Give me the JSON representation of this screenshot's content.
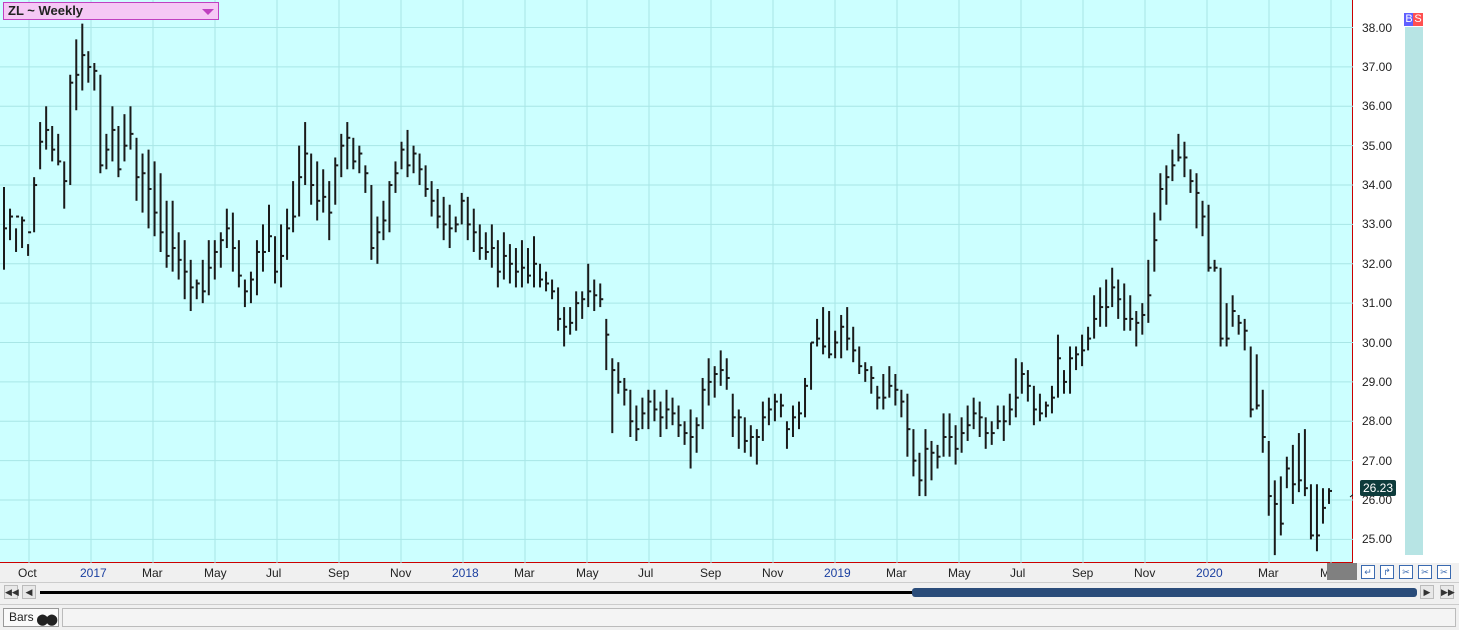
{
  "symbol_selector": {
    "label": "ZL ~ Weekly"
  },
  "buy_label": "B",
  "sell_label": "S",
  "last_price": "26.23",
  "bottom_tab": {
    "label": "Bars"
  },
  "colors": {
    "plot_bg": "#ccffff",
    "grid": "#a8e6e6",
    "bars": "#1a1a1a",
    "border": "#cc0000",
    "year_label": "#1a3fa0"
  },
  "nav_icons": [
    "arrow-left-icon",
    "arrow-right-icon",
    "zoom-in-icon",
    "zoom-out-icon",
    "collapse-icon"
  ],
  "chart_data": {
    "type": "ohlc",
    "y_tick_labels": [
      "38.00",
      "37.00",
      "36.00",
      "35.00",
      "34.00",
      "33.00",
      "32.00",
      "31.00",
      "30.00",
      "29.00",
      "28.00",
      "27.00",
      "26.00",
      "25.00"
    ],
    "ylim": [
      24.4,
      38.7
    ],
    "x_tick_labels": [
      {
        "label": "Oct",
        "year": false
      },
      {
        "label": "2017",
        "year": true
      },
      {
        "label": "Mar",
        "year": false
      },
      {
        "label": "May",
        "year": false
      },
      {
        "label": "Jul",
        "year": false
      },
      {
        "label": "Sep",
        "year": false
      },
      {
        "label": "Nov",
        "year": false
      },
      {
        "label": "2018",
        "year": true
      },
      {
        "label": "Mar",
        "year": false
      },
      {
        "label": "May",
        "year": false
      },
      {
        "label": "Jul",
        "year": false
      },
      {
        "label": "Sep",
        "year": false
      },
      {
        "label": "Nov",
        "year": false
      },
      {
        "label": "2019",
        "year": true
      },
      {
        "label": "Mar",
        "year": false
      },
      {
        "label": "May",
        "year": false
      },
      {
        "label": "Jul",
        "year": false
      },
      {
        "label": "Sep",
        "year": false
      },
      {
        "label": "Nov",
        "year": false
      },
      {
        "label": "2020",
        "year": true
      },
      {
        "label": "Mar",
        "year": false
      },
      {
        "label": "May",
        "year": false
      }
    ],
    "grid": true,
    "series": [
      {
        "values": [
          [
            33.95,
            31.85,
            32.9
          ],
          [
            33.4,
            32.6,
            33.2
          ],
          [
            32.9,
            32.3,
            33.2
          ],
          [
            33.2,
            32.4,
            33.1
          ],
          [
            32.5,
            32.2,
            32.8
          ],
          [
            34.2,
            32.8,
            34.0
          ],
          [
            35.6,
            34.4,
            35.1
          ],
          [
            36.0,
            34.9,
            35.4
          ],
          [
            35.5,
            34.6,
            34.9
          ],
          [
            35.3,
            34.5,
            34.6
          ],
          [
            34.6,
            33.4,
            34.1
          ],
          [
            36.8,
            34.0,
            36.6
          ],
          [
            37.7,
            35.9,
            36.8
          ],
          [
            38.1,
            36.4,
            37.3
          ],
          [
            37.4,
            36.6,
            37.0
          ],
          [
            37.1,
            36.4,
            36.9
          ],
          [
            36.8,
            34.3,
            34.5
          ],
          [
            35.3,
            34.4,
            34.9
          ],
          [
            36.0,
            34.6,
            35.4
          ],
          [
            35.5,
            34.2,
            34.4
          ],
          [
            35.8,
            34.6,
            35.0
          ],
          [
            36.0,
            34.9,
            35.3
          ],
          [
            35.2,
            33.6,
            34.2
          ],
          [
            34.8,
            33.3,
            34.3
          ],
          [
            34.9,
            32.9,
            33.9
          ],
          [
            34.6,
            32.7,
            33.3
          ],
          [
            34.3,
            32.3,
            32.8
          ],
          [
            33.6,
            31.9,
            32.2
          ],
          [
            33.6,
            31.8,
            32.4
          ],
          [
            32.8,
            31.6,
            32.1
          ],
          [
            32.6,
            31.1,
            31.8
          ],
          [
            32.1,
            30.8,
            31.4
          ],
          [
            31.6,
            31.1,
            31.5
          ],
          [
            32.1,
            31.0,
            31.3
          ],
          [
            32.6,
            31.2,
            31.9
          ],
          [
            32.6,
            31.6,
            32.3
          ],
          [
            32.8,
            31.9,
            32.6
          ],
          [
            33.4,
            32.4,
            32.9
          ],
          [
            33.3,
            31.8,
            32.4
          ],
          [
            32.6,
            31.4,
            31.7
          ],
          [
            31.6,
            30.9,
            31.3
          ],
          [
            31.8,
            31.0,
            31.6
          ],
          [
            32.6,
            31.2,
            32.3
          ],
          [
            33.0,
            31.8,
            32.3
          ],
          [
            33.5,
            32.3,
            32.7
          ],
          [
            32.7,
            31.5,
            31.8
          ],
          [
            33.0,
            31.4,
            32.2
          ],
          [
            33.4,
            32.1,
            32.9
          ],
          [
            34.1,
            32.8,
            33.2
          ],
          [
            35.0,
            33.2,
            34.2
          ],
          [
            35.6,
            34.0,
            34.8
          ],
          [
            34.8,
            33.5,
            34.0
          ],
          [
            34.6,
            33.1,
            33.6
          ],
          [
            34.4,
            33.3,
            33.7
          ],
          [
            34.1,
            32.6,
            33.3
          ],
          [
            34.7,
            33.5,
            34.5
          ],
          [
            35.3,
            34.2,
            35.0
          ],
          [
            35.6,
            34.4,
            35.2
          ],
          [
            35.2,
            34.4,
            34.6
          ],
          [
            35.0,
            34.3,
            34.8
          ],
          [
            34.5,
            33.8,
            34.3
          ],
          [
            34.0,
            32.1,
            32.4
          ],
          [
            33.2,
            32.0,
            32.8
          ],
          [
            33.6,
            32.6,
            33.1
          ],
          [
            34.1,
            32.8,
            34.0
          ],
          [
            34.6,
            33.8,
            34.3
          ],
          [
            35.1,
            34.4,
            34.9
          ],
          [
            35.4,
            34.2,
            34.5
          ],
          [
            35.0,
            34.3,
            34.8
          ],
          [
            34.8,
            34.0,
            34.4
          ],
          [
            34.5,
            33.7,
            33.9
          ],
          [
            34.1,
            33.2,
            33.6
          ],
          [
            33.9,
            32.9,
            33.2
          ],
          [
            33.7,
            32.6,
            33.0
          ],
          [
            33.5,
            32.4,
            32.9
          ],
          [
            33.2,
            32.8,
            33.0
          ],
          [
            33.8,
            33.0,
            33.6
          ],
          [
            33.7,
            32.6,
            33.0
          ],
          [
            33.4,
            32.3,
            32.8
          ],
          [
            33.0,
            32.1,
            32.4
          ],
          [
            32.8,
            32.1,
            32.3
          ],
          [
            33.0,
            31.9,
            32.4
          ],
          [
            32.6,
            31.4,
            31.8
          ],
          [
            32.8,
            31.6,
            32.2
          ],
          [
            32.5,
            31.5,
            32.0
          ],
          [
            32.4,
            31.4,
            31.8
          ],
          [
            32.6,
            31.4,
            31.9
          ],
          [
            32.4,
            31.5,
            31.7
          ],
          [
            32.7,
            31.4,
            32.0
          ],
          [
            32.0,
            31.4,
            31.6
          ],
          [
            31.8,
            31.3,
            31.5
          ],
          [
            31.6,
            31.1,
            31.3
          ],
          [
            31.4,
            30.3,
            30.6
          ],
          [
            30.9,
            29.9,
            30.4
          ],
          [
            30.9,
            30.2,
            30.5
          ],
          [
            31.3,
            30.3,
            31.0
          ],
          [
            31.3,
            30.6,
            31.1
          ],
          [
            32.0,
            30.9,
            31.3
          ],
          [
            31.6,
            30.8,
            31.2
          ],
          [
            31.5,
            30.9,
            31.1
          ],
          [
            30.6,
            29.3,
            30.2
          ],
          [
            29.6,
            27.7,
            29.3
          ],
          [
            29.5,
            28.7,
            29.0
          ],
          [
            29.1,
            28.4,
            28.8
          ],
          [
            28.8,
            27.6,
            28.0
          ],
          [
            28.4,
            27.5,
            27.8
          ],
          [
            28.6,
            27.8,
            28.2
          ],
          [
            28.8,
            27.8,
            28.5
          ],
          [
            28.8,
            28.0,
            28.3
          ],
          [
            28.5,
            27.6,
            28.1
          ],
          [
            28.8,
            27.8,
            28.3
          ],
          [
            28.6,
            27.9,
            28.2
          ],
          [
            28.4,
            27.6,
            27.9
          ],
          [
            28.0,
            27.4,
            27.7
          ],
          [
            28.3,
            26.8,
            27.6
          ],
          [
            28.1,
            27.2,
            27.9
          ],
          [
            29.1,
            27.8,
            28.8
          ],
          [
            29.6,
            28.4,
            29.0
          ],
          [
            29.4,
            28.6,
            29.2
          ],
          [
            29.8,
            28.9,
            29.3
          ],
          [
            29.6,
            28.8,
            29.1
          ],
          [
            28.7,
            27.6,
            28.1
          ],
          [
            28.3,
            27.3,
            28.1
          ],
          [
            28.1,
            27.2,
            27.5
          ],
          [
            27.9,
            27.1,
            27.6
          ],
          [
            27.8,
            26.9,
            27.6
          ],
          [
            28.5,
            27.5,
            28.1
          ],
          [
            28.6,
            27.9,
            28.3
          ],
          [
            28.7,
            28.0,
            28.5
          ],
          [
            28.7,
            28.1,
            28.4
          ],
          [
            28.0,
            27.3,
            27.8
          ],
          [
            28.4,
            27.6,
            28.1
          ],
          [
            28.5,
            27.8,
            28.2
          ],
          [
            29.1,
            28.1,
            28.9
          ],
          [
            30.0,
            28.8,
            30.0
          ],
          [
            30.6,
            29.9,
            30.1
          ],
          [
            30.9,
            29.7,
            29.9
          ],
          [
            30.8,
            29.6,
            29.7
          ],
          [
            30.3,
            29.6,
            30.0
          ],
          [
            30.7,
            29.6,
            30.4
          ],
          [
            30.9,
            29.8,
            30.1
          ],
          [
            30.4,
            29.5,
            29.8
          ],
          [
            29.9,
            29.2,
            29.4
          ],
          [
            29.5,
            29.0,
            29.3
          ],
          [
            29.4,
            28.7,
            29.1
          ],
          [
            28.9,
            28.3,
            28.6
          ],
          [
            29.2,
            28.3,
            28.6
          ],
          [
            29.4,
            28.6,
            28.9
          ],
          [
            29.2,
            28.4,
            28.8
          ],
          [
            28.8,
            28.1,
            28.5
          ],
          [
            28.7,
            27.1,
            27.8
          ],
          [
            27.8,
            26.6,
            27.0
          ],
          [
            27.2,
            26.1,
            26.5
          ],
          [
            27.8,
            26.1,
            27.3
          ],
          [
            27.5,
            26.5,
            27.2
          ],
          [
            27.4,
            26.8,
            27.1
          ],
          [
            28.2,
            27.1,
            27.6
          ],
          [
            28.2,
            27.1,
            27.6
          ],
          [
            27.9,
            26.9,
            27.3
          ],
          [
            28.1,
            27.2,
            27.7
          ],
          [
            28.4,
            27.5,
            27.9
          ],
          [
            28.6,
            27.8,
            28.2
          ],
          [
            28.5,
            27.6,
            28.1
          ],
          [
            28.1,
            27.3,
            27.7
          ],
          [
            28.0,
            27.4,
            27.7
          ],
          [
            28.4,
            27.8,
            28.0
          ],
          [
            28.4,
            27.5,
            28.0
          ],
          [
            28.7,
            27.9,
            28.3
          ],
          [
            29.6,
            28.1,
            28.6
          ],
          [
            29.5,
            28.7,
            29.2
          ],
          [
            29.3,
            28.5,
            28.9
          ],
          [
            28.9,
            27.9,
            28.3
          ],
          [
            28.7,
            28.0,
            28.2
          ],
          [
            28.5,
            28.1,
            28.4
          ],
          [
            28.9,
            28.2,
            28.6
          ],
          [
            30.2,
            28.6,
            29.6
          ],
          [
            29.3,
            28.7,
            29.0
          ],
          [
            29.9,
            28.7,
            29.6
          ],
          [
            29.9,
            29.3,
            29.7
          ],
          [
            30.2,
            29.4,
            29.8
          ],
          [
            30.4,
            29.8,
            30.1
          ],
          [
            31.2,
            30.1,
            30.6
          ],
          [
            31.4,
            30.4,
            30.9
          ],
          [
            31.6,
            30.4,
            30.9
          ],
          [
            31.9,
            30.9,
            31.4
          ],
          [
            31.6,
            30.6,
            31.1
          ],
          [
            31.5,
            30.3,
            30.6
          ],
          [
            31.2,
            30.3,
            30.6
          ],
          [
            30.8,
            29.9,
            30.5
          ],
          [
            31.0,
            30.2,
            30.7
          ],
          [
            32.1,
            30.5,
            31.2
          ],
          [
            33.3,
            31.8,
            32.6
          ],
          [
            34.3,
            33.1,
            33.9
          ],
          [
            34.5,
            33.5,
            34.2
          ],
          [
            34.9,
            34.1,
            34.5
          ],
          [
            35.3,
            34.6,
            34.7
          ],
          [
            35.1,
            34.2,
            34.7
          ],
          [
            34.4,
            33.8,
            34.1
          ],
          [
            34.3,
            32.9,
            33.8
          ],
          [
            33.6,
            32.7,
            33.2
          ],
          [
            33.5,
            31.8,
            31.9
          ],
          [
            32.1,
            31.8,
            31.9
          ],
          [
            31.9,
            29.9,
            30.1
          ],
          [
            31.0,
            29.9,
            30.1
          ],
          [
            31.2,
            30.4,
            30.8
          ],
          [
            30.7,
            30.2,
            30.5
          ],
          [
            30.6,
            29.8,
            30.3
          ],
          [
            29.9,
            28.1,
            28.3
          ],
          [
            29.7,
            28.3,
            28.4
          ],
          [
            28.8,
            27.2,
            27.6
          ],
          [
            27.5,
            25.6,
            26.1
          ],
          [
            26.5,
            24.6,
            25.9
          ],
          [
            26.6,
            25.1,
            25.4
          ],
          [
            27.1,
            26.3,
            26.8
          ],
          [
            27.4,
            25.9,
            26.4
          ],
          [
            27.7,
            26.2,
            26.5
          ],
          [
            27.8,
            26.1,
            26.3
          ],
          [
            26.4,
            25.0,
            25.1
          ],
          [
            26.4,
            24.7,
            25.1
          ],
          [
            26.3,
            25.4,
            25.8
          ],
          [
            26.3,
            25.9,
            26.23
          ]
        ]
      }
    ]
  }
}
